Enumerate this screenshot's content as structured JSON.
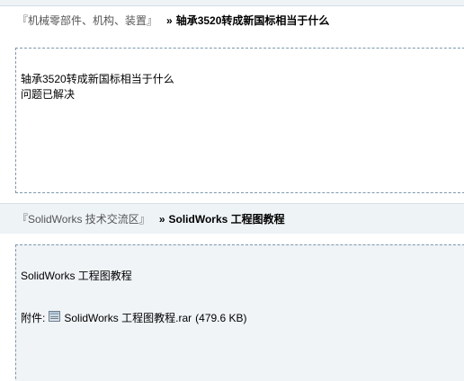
{
  "posts": [
    {
      "forum": "『机械零部件、机构、装置』",
      "raquo": "»",
      "title": "轴承3520转成新国标相当于什么",
      "body_lines": [
        "轴承3520转成新国标相当于什么",
        "问题已解决"
      ]
    },
    {
      "forum": "『SolidWorks 技术交流区』",
      "raquo": "»",
      "title": "SolidWorks 工程图教程",
      "body_lines": [
        "SolidWorks 工程图教程"
      ],
      "attachment": {
        "label": "附件:",
        "icon": "rar-file-icon",
        "filename": "SolidWorks 工程图教程.rar",
        "size": "(479.6 KB)"
      }
    }
  ],
  "colors": {
    "header_bg": "#eef3f6",
    "dashed_border": "#7b98ad",
    "forum_link": "#555555"
  }
}
